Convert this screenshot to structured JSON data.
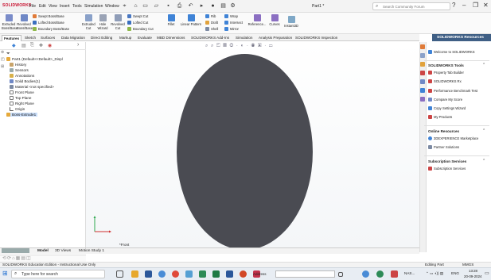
{
  "app": {
    "logo": "SOLIDWORKS",
    "document_title": "Part1 *",
    "menu": [
      "File",
      "Edit",
      "View",
      "Insert",
      "Tools",
      "Simulation",
      "Window"
    ],
    "search_placeholder": "Search Community Forum"
  },
  "ribbon": {
    "big_buttons": [
      {
        "label": "Extruded Boss/Base",
        "icon": "extrude-boss-icon",
        "color": "#7a8cc9"
      },
      {
        "label": "Revolved Boss/Base",
        "icon": "revolve-boss-icon",
        "color": "#6f88c6"
      },
      {
        "label": "Extruded Cut",
        "icon": "extrude-cut-icon",
        "color": "#8aa1c9"
      },
      {
        "label": "Hole Wizard",
        "icon": "hole-wizard-icon",
        "color": "#9aa3b5"
      },
      {
        "label": "Revolved Cut",
        "icon": "revolve-cut-icon",
        "color": "#8f9db8"
      },
      {
        "label": "Instant3D",
        "icon": "instant3d-icon",
        "color": "#7fa8c7"
      }
    ],
    "small_buttons": [
      {
        "label": "Swept Boss/Base",
        "icon": "swept-boss-icon",
        "color": "#e07b39"
      },
      {
        "label": "Lofted Boss/Base",
        "icon": "loft-boss-icon",
        "color": "#3a6fbf"
      },
      {
        "label": "Boundary Boss/Base",
        "icon": "boundary-boss-icon",
        "color": "#8fb84a"
      },
      {
        "label": "Swept Cut",
        "icon": "swept-cut-icon",
        "color": "#4a78c2"
      },
      {
        "label": "Lofted Cut",
        "icon": "loft-cut-icon",
        "color": "#3a6fbf"
      },
      {
        "label": "Boundary Cut",
        "icon": "boundary-cut-icon",
        "color": "#8fb84a"
      },
      {
        "label": "Fillet",
        "icon": "fillet-icon",
        "color": "#3f83d6"
      },
      {
        "label": "Linear Pattern",
        "icon": "linear-pattern-icon",
        "color": "#3f83d6"
      },
      {
        "label": "Rib",
        "icon": "rib-icon",
        "color": "#3f83d6"
      },
      {
        "label": "Draft",
        "icon": "draft-icon",
        "color": "#e1a23c"
      },
      {
        "label": "Shell",
        "icon": "shell-icon",
        "color": "#7c8aa3"
      },
      {
        "label": "Wrap",
        "icon": "wrap-icon",
        "color": "#3f83d6"
      },
      {
        "label": "Intersect",
        "icon": "intersect-icon",
        "color": "#3f83d6"
      },
      {
        "label": "Mirror",
        "icon": "mirror-icon",
        "color": "#3f83d6"
      },
      {
        "label": "Reference...",
        "icon": "reference-geometry-icon",
        "color": "#8b6fc2"
      },
      {
        "label": "Curves",
        "icon": "curves-icon",
        "color": "#8b6fc2"
      }
    ]
  },
  "tabs": [
    "Features",
    "Sketch",
    "Surfaces",
    "Data Migration",
    "Direct Editing",
    "Markup",
    "Evaluate",
    "MBD Dimensions",
    "SOLIDWORKS Add-Ins",
    "Simulation",
    "Analysis Preparation",
    "SOLIDWORKS Inspection"
  ],
  "feature_tree": {
    "root": "Part1 (Default<<Default>_Displ",
    "items": [
      "History",
      "Sensors",
      "Annotations",
      "Solid Bodies(1)",
      "Material <not specified>",
      "Front Plane",
      "Top Plane",
      "Right Plane",
      "Origin",
      "Boss-Extrude1"
    ],
    "selected": "Boss-Extrude1"
  },
  "graphics": {
    "view_label": "*Front",
    "body_color": "#4a4b52"
  },
  "task_pane": {
    "title": "SOLIDWORKS Resources",
    "welcome": "Welcome to SOLIDWORKS",
    "sections": [
      {
        "title": "SOLIDWORKS Tools",
        "items": [
          "Property Tab Builder",
          "SOLIDWORKS Rx",
          "Performance Benchmark Test",
          "Compare My Score",
          "Copy Settings Wizard",
          "My Products"
        ]
      },
      {
        "title": "Online Resources",
        "items": [
          "3DEXPERIENCE Marketplace",
          "Partner Solutions"
        ]
      },
      {
        "title": "Subscription Services",
        "items": [
          "Subscription Services"
        ]
      }
    ]
  },
  "bottom_tabs": [
    "Model",
    "3D Views",
    "Motion Study 1"
  ],
  "status": {
    "left": "SOLIDWORKS Education Edition - Instructional Use Only",
    "mode": "Editing Part",
    "units": "MMGS"
  },
  "taskbar": {
    "search_placeholder": "Type here for search",
    "address_label": "Address",
    "tray_text": "NAS...",
    "language": "ENG",
    "time": "13:28",
    "date": "20-09-2024"
  }
}
